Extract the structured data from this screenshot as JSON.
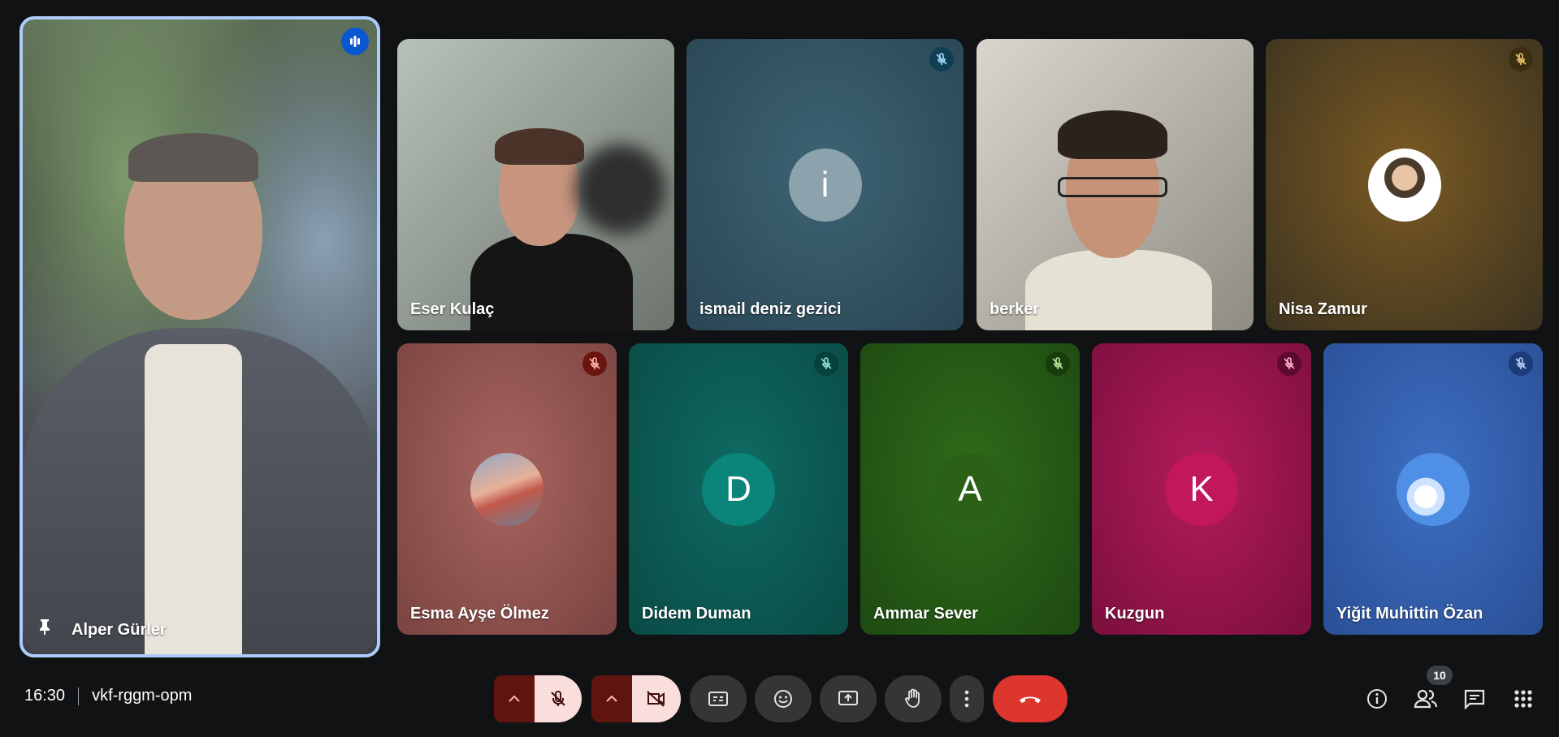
{
  "speaker": {
    "name": "Alper Gürler"
  },
  "top_row": [
    {
      "name": "Eser Kulaç",
      "type": "video"
    },
    {
      "name": "ismail deniz gezici",
      "type": "avatar",
      "initial": "i",
      "muted": true
    },
    {
      "name": "berker",
      "type": "video"
    },
    {
      "name": "Nisa Zamur",
      "type": "photo",
      "muted": true
    }
  ],
  "bottom_row": [
    {
      "name": "Esma Ayşe Ölmez",
      "type": "photo",
      "muted": true
    },
    {
      "name": "Didem Duman",
      "type": "avatar",
      "initial": "D",
      "muted": true
    },
    {
      "name": "Ammar Sever",
      "type": "avatar",
      "initial": "A",
      "muted": true
    },
    {
      "name": "Kuzgun",
      "type": "avatar",
      "initial": "K",
      "muted": true
    },
    {
      "name": "Yiğit Muhittin Özan",
      "type": "photo",
      "muted": true
    }
  ],
  "meeting": {
    "time": "16:30",
    "code": "vkf-rggm-opm"
  },
  "people_count": "10",
  "colors": {
    "end_call": "#ea4335",
    "speaker_border": "#aecbfa",
    "mic_off_bg": "#f9dedc"
  }
}
